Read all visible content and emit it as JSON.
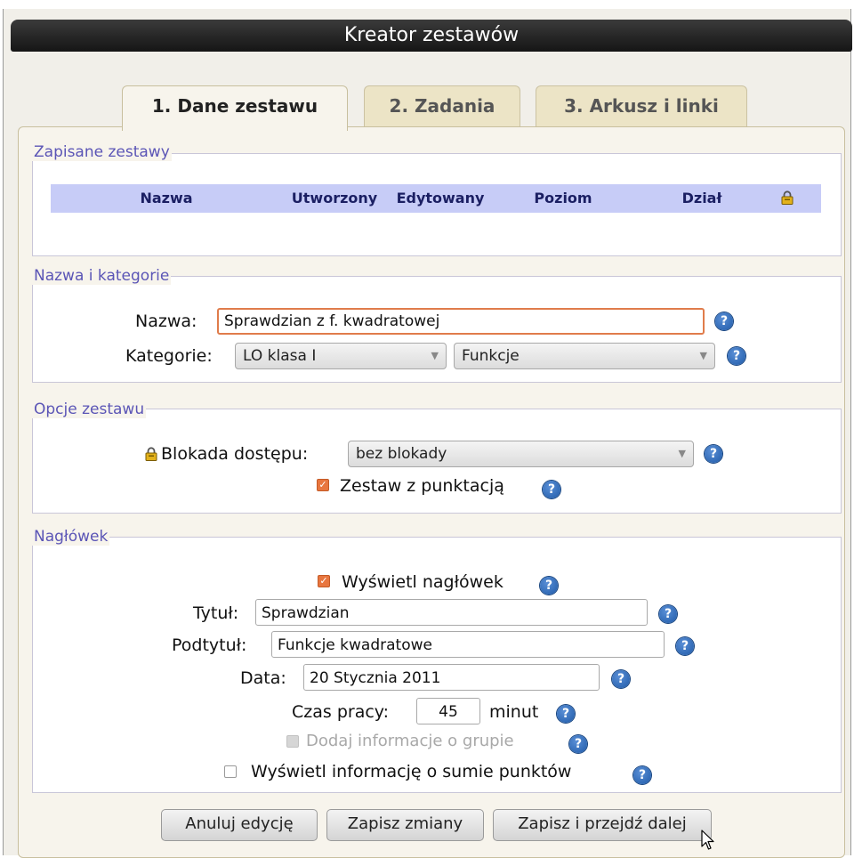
{
  "window": {
    "title": "Kreator zestawów"
  },
  "tabs": [
    {
      "label": "1. Dane zestawu",
      "active": true
    },
    {
      "label": "2. Zadania",
      "active": false
    },
    {
      "label": "3. Arkusz i linki",
      "active": false
    }
  ],
  "saved_sets": {
    "legend": "Zapisane zestawy",
    "columns": [
      "Nazwa",
      "Utworzony",
      "Edytowany",
      "Poziom",
      "Dział"
    ],
    "lock_column_icon": "lock-icon",
    "rows": []
  },
  "name_category": {
    "legend": "Nazwa i kategorie",
    "name_label": "Nazwa:",
    "name_value": "Sprawdzian z f. kwadratowej",
    "category_label": "Kategorie:",
    "category_1": "LO klasa I",
    "category_2": "Funkcje"
  },
  "options": {
    "legend": "Opcje zestawu",
    "access_lock_label": "Blokada dostępu:",
    "access_lock_value": "bez blokady",
    "scoring_label": "Zestaw z punktacją",
    "scoring_checked": true
  },
  "header": {
    "legend": "Nagłówek",
    "show_header_label": "Wyświetl nagłówek",
    "show_header_checked": true,
    "title_label": "Tytuł:",
    "title_value": "Sprawdzian",
    "subtitle_label": "Podtytuł:",
    "subtitle_value": "Funkcje kwadratowe",
    "date_label": "Data:",
    "date_value": "20 Stycznia 2011",
    "time_label": "Czas pracy:",
    "time_value": "45",
    "time_unit": "minut",
    "group_info_label": "Dodaj informacje o grupie",
    "group_info_checked": false,
    "group_info_disabled": true,
    "points_sum_label": "Wyświetl informację o sumie punktów",
    "points_sum_checked": false
  },
  "help_icon": "?",
  "buttons": {
    "cancel": "Anuluj edycję",
    "save": "Zapisz zmiany",
    "save_next": "Zapisz i przejdź dalej"
  },
  "colors": {
    "accent": "#e8763f",
    "legend_text": "#5b55b6",
    "table_header_bg": "#c7ccf7",
    "help_icon": "#1f5aa8"
  }
}
